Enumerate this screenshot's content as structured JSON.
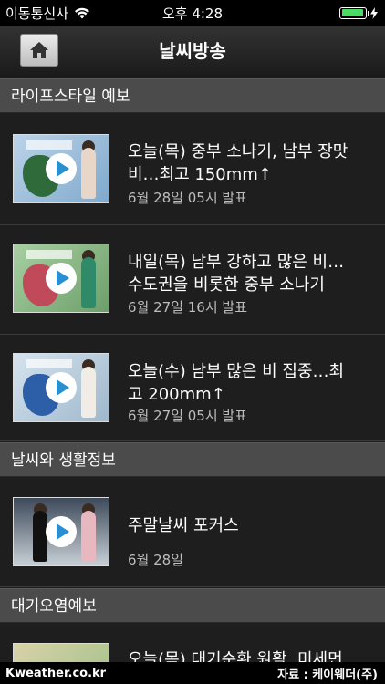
{
  "status": {
    "carrier": "이동통신사",
    "time": "오후 4:28",
    "battery_level": 0.95,
    "icons": [
      "wifi-icon",
      "battery-icon",
      "charging-bolt-icon"
    ]
  },
  "nav": {
    "title": "날씨방송",
    "home_icon": "home-icon"
  },
  "sections": [
    {
      "title": "라이프스타일 예보",
      "items": [
        {
          "title_line1": "오늘(목) 중부 소나기, 남부 장맛",
          "title_line2": "비…최고 150mm↑",
          "date": "6월 28일 05시 발표"
        },
        {
          "title_line1": "내일(목) 남부 강하고 많은 비…",
          "title_line2": "수도권을 비롯한 중부 소나기",
          "date": "6월 27일 16시 발표"
        },
        {
          "title_line1": "오늘(수) 남부 많은 비 집중…최",
          "title_line2": "고 200mm↑",
          "date": "6월 27일 05시 발표"
        }
      ]
    },
    {
      "title": "날씨와 생활정보",
      "items": [
        {
          "title_line1": "주말날씨 포커스",
          "title_line2": "",
          "date": "6월 28일"
        }
      ]
    },
    {
      "title": "대기오염예보",
      "items": [
        {
          "title_line1": "오늘(목) 대기순환 원활, 미세먼",
          "title_line2": "",
          "date": ""
        }
      ]
    }
  ],
  "footer": {
    "brand": "Kweather.co.kr",
    "source": "자료 : 케이웨더(주)"
  },
  "colors": {
    "background": "#1e1e1e",
    "section_header": "#4b4b4b",
    "play_accent": "#2a8fd0",
    "battery": "#4cd964"
  }
}
